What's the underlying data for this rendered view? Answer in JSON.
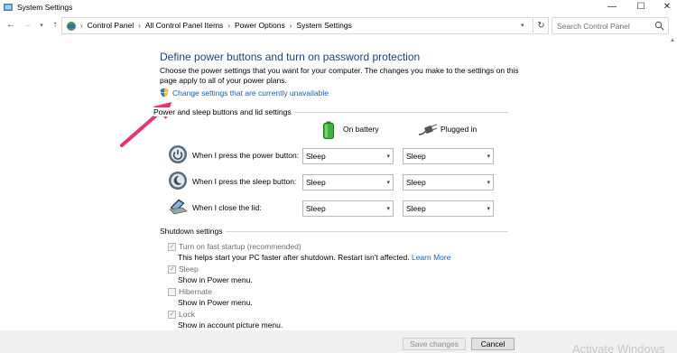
{
  "window": {
    "title": "System Settings",
    "min_glyph": "—",
    "max_glyph": "☐",
    "close_glyph": "✕"
  },
  "nav": {
    "breadcrumbs": [
      "Control Panel",
      "All Control Panel Items",
      "Power Options",
      "System Settings"
    ],
    "search_placeholder": "Search Control Panel"
  },
  "main": {
    "heading": "Define power buttons and turn on password protection",
    "description": "Choose the power settings that you want for your computer. The changes you make to the settings on this page apply to all of your power plans.",
    "change_link": "Change settings that are currently unavailable",
    "power_section_title": "Power and sleep buttons and lid settings",
    "col_battery": "On battery",
    "col_plugged": "Plugged in",
    "rows": [
      {
        "label": "When I press the power button:",
        "battery": "Sleep",
        "plugged": "Sleep",
        "icon": "power-button-icon"
      },
      {
        "label": "When I press the sleep button:",
        "battery": "Sleep",
        "plugged": "Sleep",
        "icon": "sleep-button-icon"
      },
      {
        "label": "When I close the lid:",
        "battery": "Sleep",
        "plugged": "Sleep",
        "icon": "laptop-lid-icon"
      }
    ],
    "shutdown_section_title": "Shutdown settings",
    "shutdown": [
      {
        "label": "Turn on fast startup (recommended)",
        "checked": true,
        "desc": "This helps start your PC faster after shutdown. Restart isn't affected.",
        "link": "Learn More"
      },
      {
        "label": "Sleep",
        "checked": true,
        "desc": "Show in Power menu."
      },
      {
        "label": "Hibernate",
        "checked": false,
        "desc": "Show in Power menu."
      },
      {
        "label": "Lock",
        "checked": true,
        "desc": "Show in account picture menu."
      }
    ]
  },
  "buttons": {
    "save": "Save changes",
    "cancel": "Cancel"
  },
  "watermark": "Activate Windows",
  "colors": {
    "heading": "#1e3f8f",
    "link": "#1a5fb4",
    "arrow": "#e8336b"
  }
}
